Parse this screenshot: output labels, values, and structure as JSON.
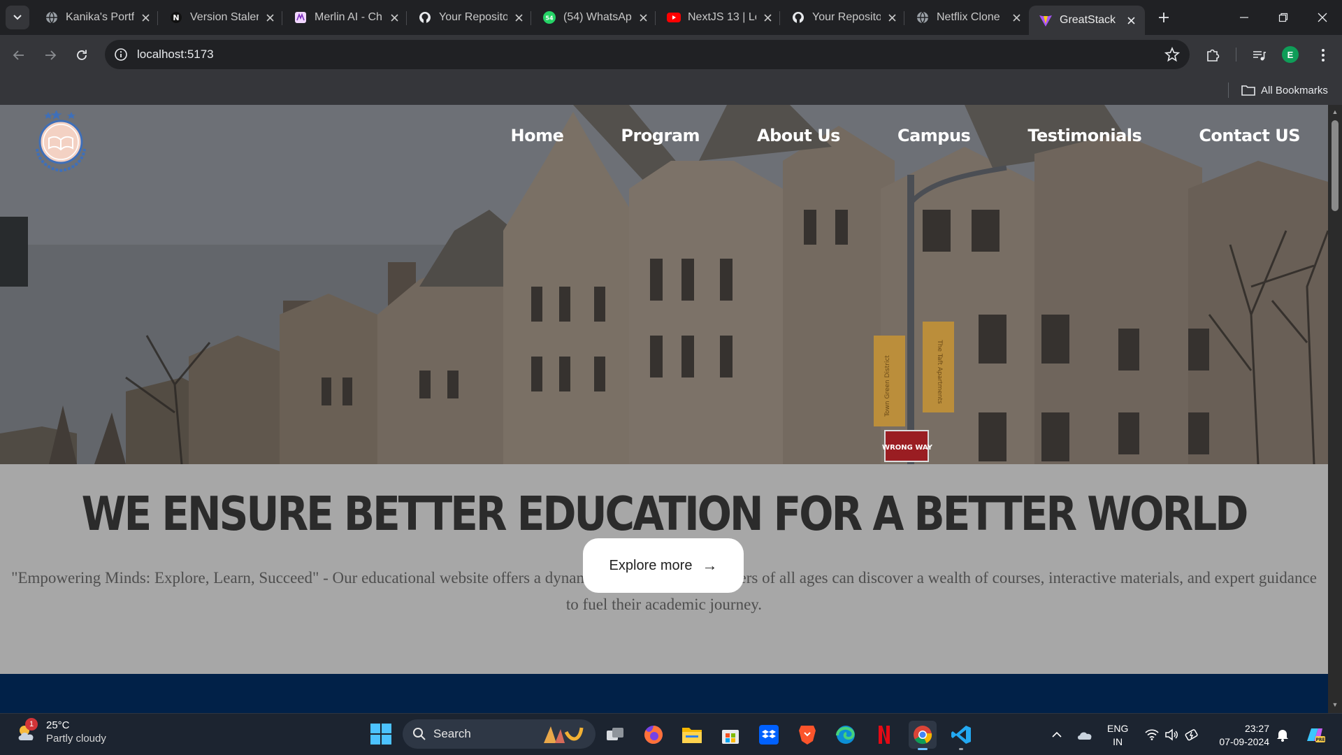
{
  "browser": {
    "tabs": [
      {
        "title": "Kanika's Portf",
        "icon": "globe-icon",
        "active": false
      },
      {
        "title": "Version Staler",
        "icon": "notion-icon",
        "active": false
      },
      {
        "title": "Merlin AI - Ch",
        "icon": "merlin-icon",
        "active": false
      },
      {
        "title": "Your Reposito",
        "icon": "github-icon",
        "active": false
      },
      {
        "title": "(54) WhatsAp",
        "icon": "whatsapp-icon",
        "active": false
      },
      {
        "title": "NextJS 13 | Le",
        "icon": "youtube-icon",
        "active": false
      },
      {
        "title": "Your Reposito",
        "icon": "github-icon",
        "active": false
      },
      {
        "title": "Netflix Clone",
        "icon": "globe-icon",
        "active": false
      },
      {
        "title": "GreatStack",
        "icon": "vite-icon",
        "active": true
      }
    ],
    "url": "localhost:5173",
    "profile_initial": "E",
    "bookmarks_label": "All Bookmarks"
  },
  "site": {
    "nav": [
      "Home",
      "Program",
      "About Us",
      "Campus",
      "Testimonials",
      "Contact US"
    ],
    "headline": "We Ensure better education for a better world",
    "subtext": "\"Empowering Minds: Explore, Learn, Succeed\" - Our educational website offers a dynamic platform where learners of all ages can discover a wealth of courses, interactive materials, and expert guidance to fuel their academic journey.",
    "explore_label": "Explore more",
    "explore_arrow": "→",
    "hero_sign_text": "WRONG WAY",
    "banner_1": "Town Green District",
    "banner_2": "The Taft Apartments",
    "colors": {
      "footer_band": "#012148",
      "content_bg": "#a7a7a7",
      "headline": "#2b2b2b"
    }
  },
  "taskbar": {
    "weather_temp": "25°C",
    "weather_desc": "Partly cloudy",
    "weather_badge": "1",
    "search_placeholder": "Search",
    "apps": [
      "task-view-icon",
      "firefox-icon",
      "file-explorer-icon",
      "microsoft-store-icon",
      "dropbox-icon",
      "brave-icon",
      "edge-icon",
      "netflix-icon",
      "chrome-icon",
      "vscode-icon"
    ],
    "lang_line1": "ENG",
    "lang_line2": "IN",
    "time": "23:27",
    "date": "07-09-2024"
  }
}
